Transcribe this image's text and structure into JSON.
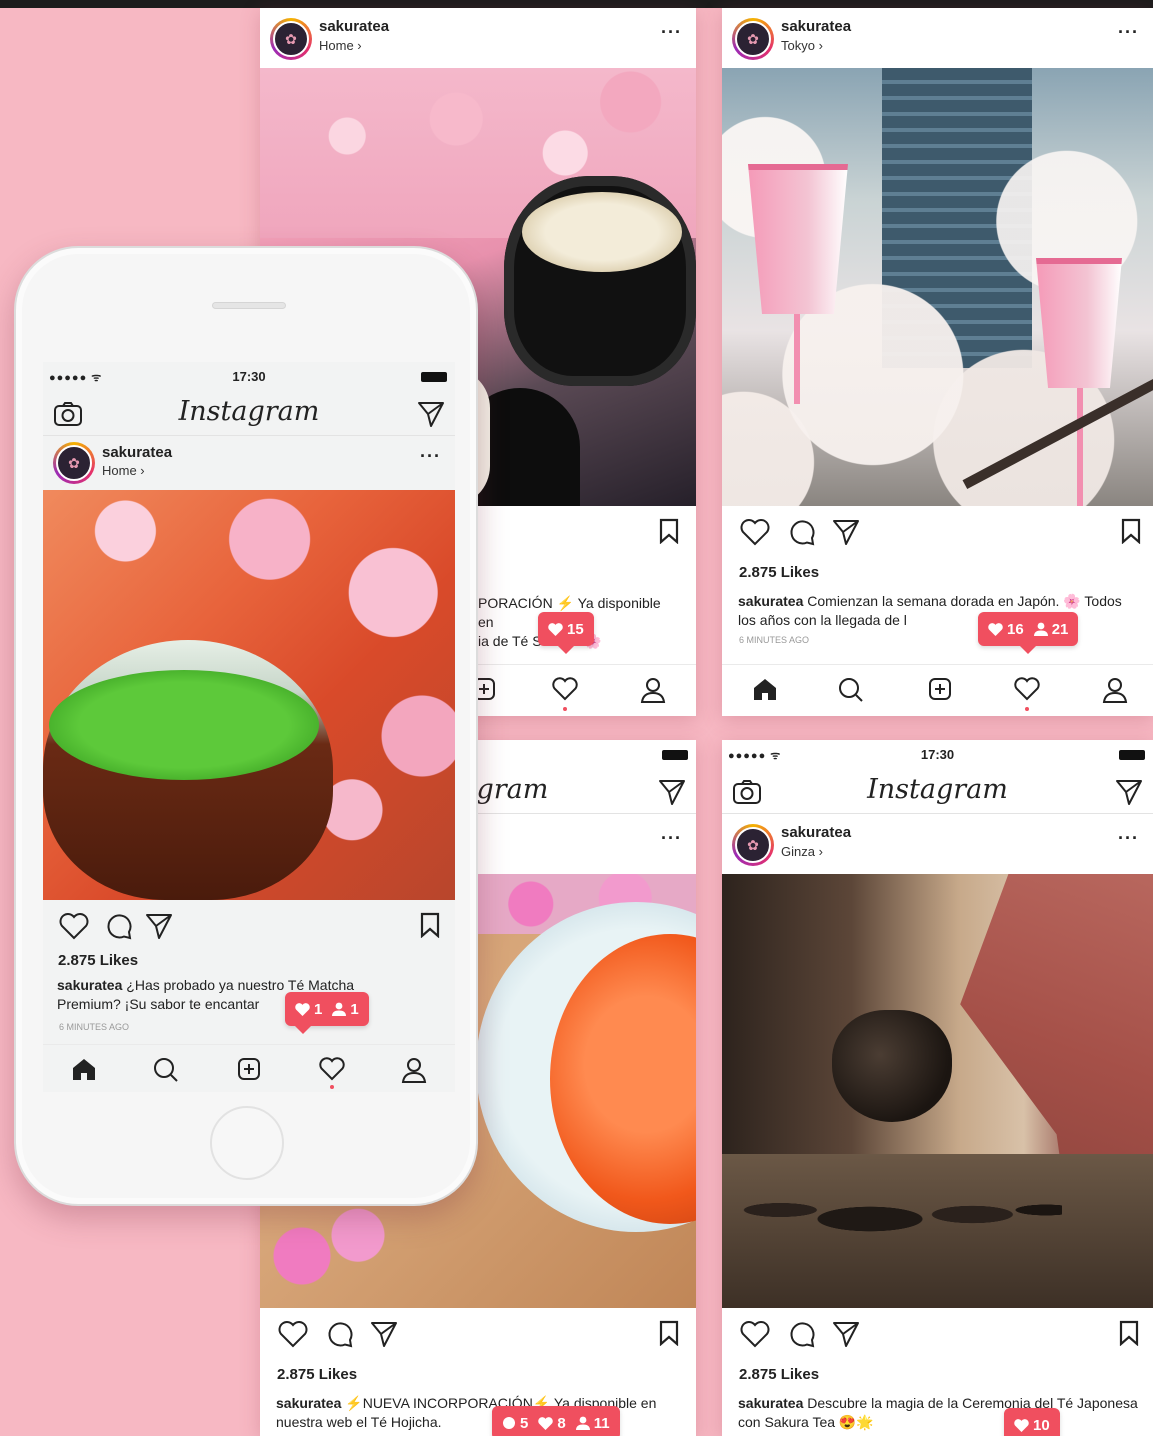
{
  "brand": {
    "app_logo": "Instagram",
    "accent": "#f04f5f",
    "background": "#f7b8c3"
  },
  "status": {
    "time": "17:30",
    "signal": "●●●●● ᯤ"
  },
  "account": {
    "username": "sakuratea"
  },
  "posts": [
    {
      "location": "Home",
      "likes": "",
      "caption_text": "PORACIÓN ⚡ Ya disponible en\nia de Té S    emon 🌸",
      "ago": "",
      "notif": {
        "likes": "15"
      }
    },
    {
      "location": "Tokyo",
      "likes": "2.875 Likes",
      "caption_text": " Comienzan la semana dorada en Japón. 🌸 Todos los años con la llegada de l",
      "ago": "6 MINUTES AGO",
      "notif": {
        "likes": "16",
        "follows": "21"
      }
    },
    {
      "location": "",
      "likes": "2.875 Likes",
      "caption_text": " ⚡NUEVA INCORPORACIÓN⚡ Ya disponible en nuestra web el Té Hojicha.",
      "ago": "",
      "notif": {
        "comments": "5",
        "likes": "8",
        "follows": "11"
      }
    },
    {
      "location": "Ginza",
      "likes": "2.875 Likes",
      "caption_text": " Descubre la magia de la Ceremonia del Té Japonesa con Sakura Tea 😍🌟",
      "ago": "",
      "notif": {
        "likes": "10"
      }
    }
  ],
  "phone_post": {
    "location": "Home",
    "likes": "2.875 Likes",
    "caption_text": " ¿Has probado ya nuestro Té Matcha Premium? ¡Su sabor te encantar",
    "ago": "6 MINUTES AGO",
    "notif": {
      "likes": "1",
      "follows": "1"
    }
  },
  "icons": [
    "camera-icon",
    "send-icon",
    "heart-icon",
    "comment-icon",
    "bookmark-icon",
    "home-icon",
    "search-icon",
    "add-icon",
    "profile-icon",
    "more-icon"
  ]
}
